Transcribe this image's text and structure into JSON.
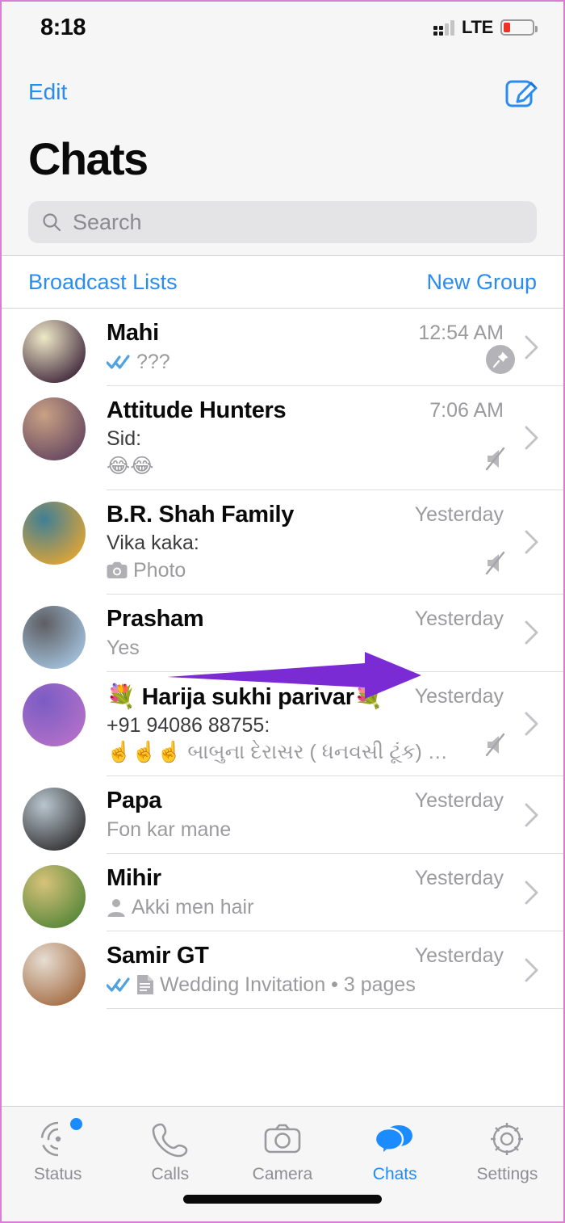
{
  "status_bar": {
    "time": "8:18",
    "network": "LTE",
    "battery_level_pct": 15
  },
  "nav": {
    "edit_label": "Edit",
    "title": "Chats",
    "compose_icon": "compose-icon"
  },
  "search": {
    "placeholder": "Search",
    "value": ""
  },
  "actions": {
    "broadcast_label": "Broadcast Lists",
    "new_group_label": "New Group"
  },
  "colors": {
    "accent_blue": "#2a8cf0",
    "tab_active_blue": "#1a8cff",
    "tick_blue": "#4fa3e3",
    "annotation_purple": "#7b2bd4",
    "battery_red": "#ef3124"
  },
  "annotation": {
    "type": "arrow",
    "points_to": "Prasham",
    "color": "#7b2bd4"
  },
  "chats": [
    {
      "name": "Mahi",
      "time": "12:54 AM",
      "sender": "",
      "preview": "???",
      "ticks": "read",
      "preview_icon": "",
      "muted": false,
      "pinned": true,
      "avatar_from": "#efe9c8",
      "avatar_to": "#4a3344"
    },
    {
      "name": "Attitude Hunters",
      "time": "7:06 AM",
      "sender": "Sid:",
      "preview": "😂😂",
      "ticks": "none",
      "preview_icon": "",
      "muted": true,
      "pinned": false,
      "avatar_from": "#c9a184",
      "avatar_to": "#6b4c62"
    },
    {
      "name": "B.R. Shah Family",
      "time": "Yesterday",
      "sender": "Vika kaka:",
      "preview": "Photo",
      "ticks": "none",
      "preview_icon": "camera-icon",
      "muted": true,
      "pinned": false,
      "avatar_from": "#3f7f96",
      "avatar_to": "#d8a33a"
    },
    {
      "name": "Prasham",
      "time": "Yesterday",
      "sender": "",
      "preview": "Yes",
      "ticks": "none",
      "preview_icon": "",
      "muted": false,
      "pinned": false,
      "avatar_from": "#5e5e62",
      "avatar_to": "#9fbcd6"
    },
    {
      "name": "💐 Harija sukhi parivar💐",
      "time": "Yesterday",
      "sender": "+91 94086 88755:",
      "preview": "☝️☝️☝️ બાબુના દેરાસર ( ધનવસી ટૂંક) ની...",
      "ticks": "none",
      "preview_icon": "",
      "muted": true,
      "pinned": false,
      "avatar_from": "#7b5cc4",
      "avatar_to": "#b06fc8"
    },
    {
      "name": "Papa",
      "time": "Yesterday",
      "sender": "",
      "preview": "Fon kar mane",
      "ticks": "none",
      "preview_icon": "",
      "muted": false,
      "pinned": false,
      "avatar_from": "#b9c6cf",
      "avatar_to": "#3a3a3c"
    },
    {
      "name": "Mihir",
      "time": "Yesterday",
      "sender": "",
      "preview": "Akki men hair",
      "ticks": "none",
      "preview_icon": "contact-icon",
      "muted": false,
      "pinned": false,
      "avatar_from": "#d7c27a",
      "avatar_to": "#5d8a3c"
    },
    {
      "name": "Samir GT",
      "time": "Yesterday",
      "sender": "",
      "preview": "Wedding Invitation • 3 pages",
      "ticks": "read",
      "preview_icon": "document-icon",
      "muted": false,
      "pinned": false,
      "avatar_from": "#e6ddd2",
      "avatar_to": "#a8734c"
    }
  ],
  "tabbar": {
    "items": [
      {
        "label": "Status",
        "icon": "status-icon",
        "active": false,
        "badge": true
      },
      {
        "label": "Calls",
        "icon": "phone-icon",
        "active": false,
        "badge": false
      },
      {
        "label": "Camera",
        "icon": "camera-icon",
        "active": false,
        "badge": false
      },
      {
        "label": "Chats",
        "icon": "chats-icon",
        "active": true,
        "badge": false
      },
      {
        "label": "Settings",
        "icon": "gear-icon",
        "active": false,
        "badge": false
      }
    ]
  }
}
